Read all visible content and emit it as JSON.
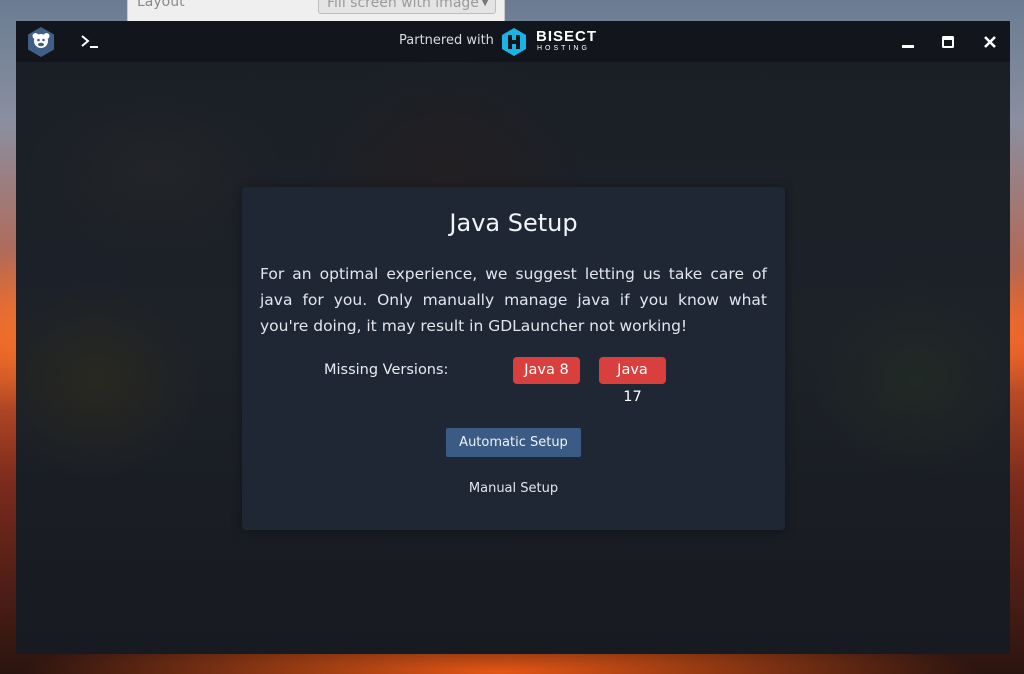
{
  "background_window": {
    "label": "Layout",
    "select_value": "Fill screen with image"
  },
  "titlebar": {
    "partner_text": "Partnered with",
    "partner_brand": "BISECT",
    "partner_brand_sub": "HOSTING",
    "icons": [
      "gdlauncher-logo-icon",
      "terminal-icon",
      "bisect-logo-icon",
      "minimize-icon",
      "maximize-icon",
      "close-icon"
    ]
  },
  "dialog": {
    "title": "Java Setup",
    "description": "For an optimal experience, we suggest letting us take care of java for you. Only manually manage java if you know what you're doing, it may result in GDLauncher not working!",
    "missing_label": "Missing Versions:",
    "missing_versions": [
      "Java 8",
      "Java 17"
    ],
    "automatic_button": "Automatic Setup",
    "manual_button": "Manual Setup"
  },
  "colors": {
    "dialog_bg": "#1f2735",
    "badge_red": "#d9403d",
    "primary_button": "#3b5a84",
    "titlebar_bg": "#12151c",
    "bisect_accent": "#1ab3e6"
  }
}
